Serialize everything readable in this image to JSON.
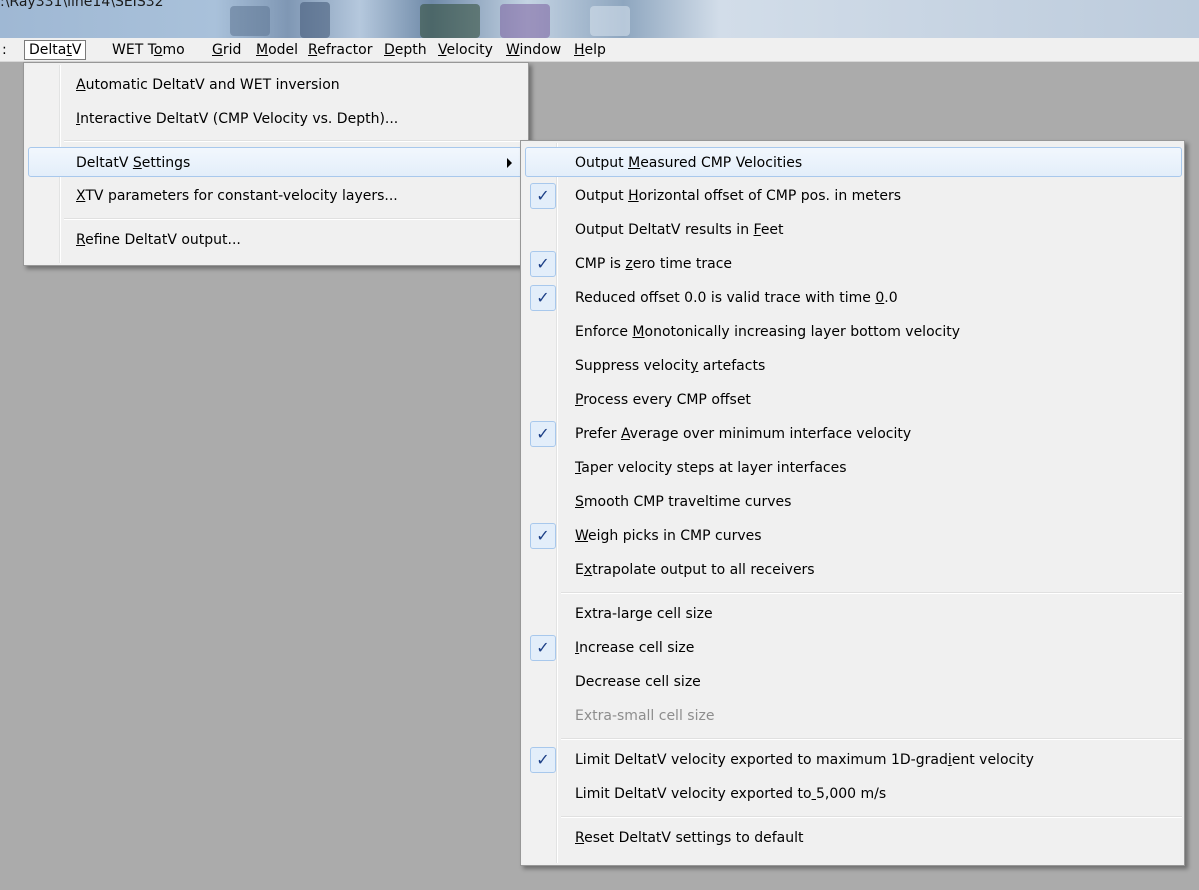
{
  "title_bar": {
    "path": ":\\Ray331\\line14\\SEIS32"
  },
  "menu_bar": {
    "stub": ":",
    "items": [
      {
        "label": "DeltatV",
        "mnemonic": 5,
        "active": true
      },
      {
        "label": "WET Tomo",
        "mnemonic": 5
      },
      {
        "label": "Grid",
        "mnemonic": 0
      },
      {
        "label": "Model",
        "mnemonic": 0
      },
      {
        "label": "Refractor",
        "mnemonic": 0
      },
      {
        "label": "Depth",
        "mnemonic": 0
      },
      {
        "label": "Velocity",
        "mnemonic": 0
      },
      {
        "label": "Window",
        "mnemonic": 0
      },
      {
        "label": "Help",
        "mnemonic": 0
      }
    ]
  },
  "deltatv_menu": {
    "items": [
      {
        "label": "Automatic DeltatV and WET inversion",
        "mnemonic": 0
      },
      {
        "label": "Interactive DeltatV (CMP Velocity vs. Depth)...",
        "mnemonic": 0
      },
      {
        "label": "DeltatV Settings",
        "mnemonic": 8,
        "submenu": true,
        "highlighted": true
      },
      {
        "label": "XTV parameters for constant-velocity layers...",
        "mnemonic": 0
      },
      {
        "label": "Refine DeltatV output...",
        "mnemonic": 0
      }
    ]
  },
  "settings_submenu": {
    "check_glyph": "✓",
    "items": [
      {
        "label": "Output Measured CMP Velocities",
        "mnemonic": 7,
        "checked": false,
        "highlighted": true
      },
      {
        "label": "Output Horizontal offset of CMP pos. in meters",
        "mnemonic": 7,
        "checked": true
      },
      {
        "label": "Output DeltatV results in Feet",
        "mnemonic": 26,
        "checked": false
      },
      {
        "label": "CMP is zero time trace",
        "mnemonic": 7,
        "checked": true
      },
      {
        "label": "Reduced offset 0.0 is valid trace with time 0.0",
        "mnemonic": 44,
        "checked": true
      },
      {
        "label": "Enforce Monotonically increasing layer bottom velocity",
        "mnemonic": 8,
        "checked": false
      },
      {
        "label": "Suppress velocity artefacts",
        "mnemonic": 16,
        "checked": false
      },
      {
        "label": "Process every CMP offset",
        "mnemonic": 0,
        "checked": false
      },
      {
        "label": "Prefer Average over minimum interface velocity",
        "mnemonic": 7,
        "checked": true
      },
      {
        "label": "Taper velocity steps at layer interfaces",
        "mnemonic": 0,
        "checked": false
      },
      {
        "label": "Smooth CMP traveltime curves",
        "mnemonic": 0,
        "checked": false
      },
      {
        "label": "Weigh picks in CMP curves",
        "mnemonic": 0,
        "checked": true
      },
      {
        "label": "Extrapolate output to all receivers",
        "mnemonic": 1,
        "checked": false
      },
      {
        "label": "Extra-large cell size",
        "mnemonic": -1,
        "checked": false
      },
      {
        "label": "Increase cell size",
        "mnemonic": 0,
        "checked": true
      },
      {
        "label": "Decrease cell size",
        "mnemonic": -1,
        "checked": false
      },
      {
        "label": "Extra-small cell size",
        "mnemonic": -1,
        "checked": false,
        "disabled": true
      },
      {
        "label": "Limit DeltatV velocity exported to maximum 1D-gradient velocity",
        "mnemonic": 50,
        "checked": true
      },
      {
        "label": "Limit DeltatV velocity exported to 5,000 m/s",
        "mnemonic": 34,
        "checked": false
      },
      {
        "label": "Reset DeltatV settings to default",
        "mnemonic": 0,
        "checked": false
      }
    ]
  }
}
